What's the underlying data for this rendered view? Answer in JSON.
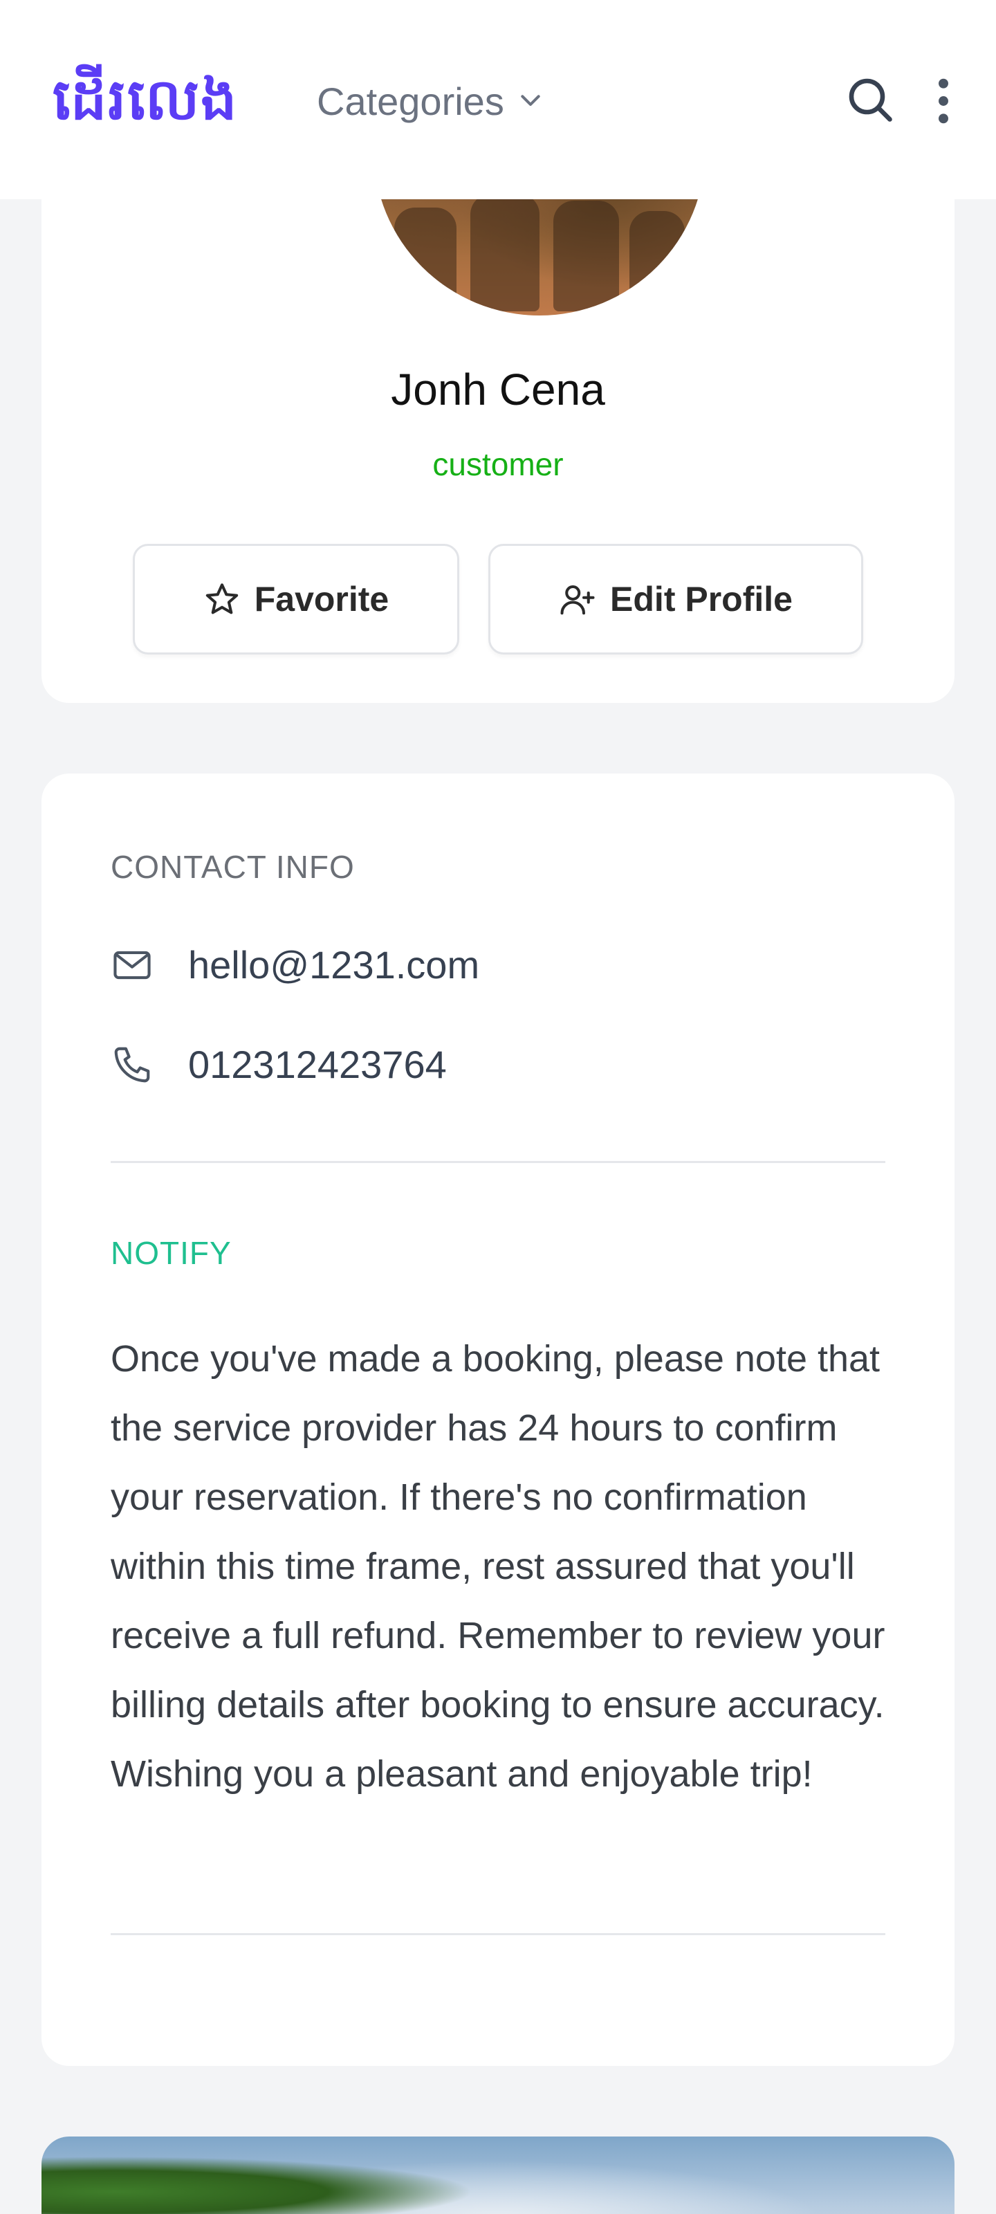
{
  "header": {
    "logo_text": "ដើរលេង",
    "categories_label": "Categories",
    "icons": {
      "dropdown": "chevron-down-icon",
      "search": "search-icon",
      "menu": "more-vertical-icon"
    }
  },
  "profile": {
    "name": "Jonh Cena",
    "role": "customer",
    "role_color": "#16b016",
    "buttons": {
      "favorite_label": "Favorite",
      "edit_label": "Edit Profile"
    }
  },
  "contact": {
    "title": "CONTACT INFO",
    "email": "hello@1231.com",
    "phone": "012312423764"
  },
  "notify": {
    "title": "NOTIFY",
    "title_color": "#1fbf8f",
    "text": "Once you've made a booking, please note that the service provider has 24 hours to confirm your reservation. If there's no confirmation within this time frame, rest assured that you'll receive a full refund. Remember to review your billing details after booking to ensure accuracy. Wishing you a pleasant and enjoyable trip!"
  },
  "colors": {
    "brand": "#5b3df5",
    "background": "#f3f4f6"
  }
}
